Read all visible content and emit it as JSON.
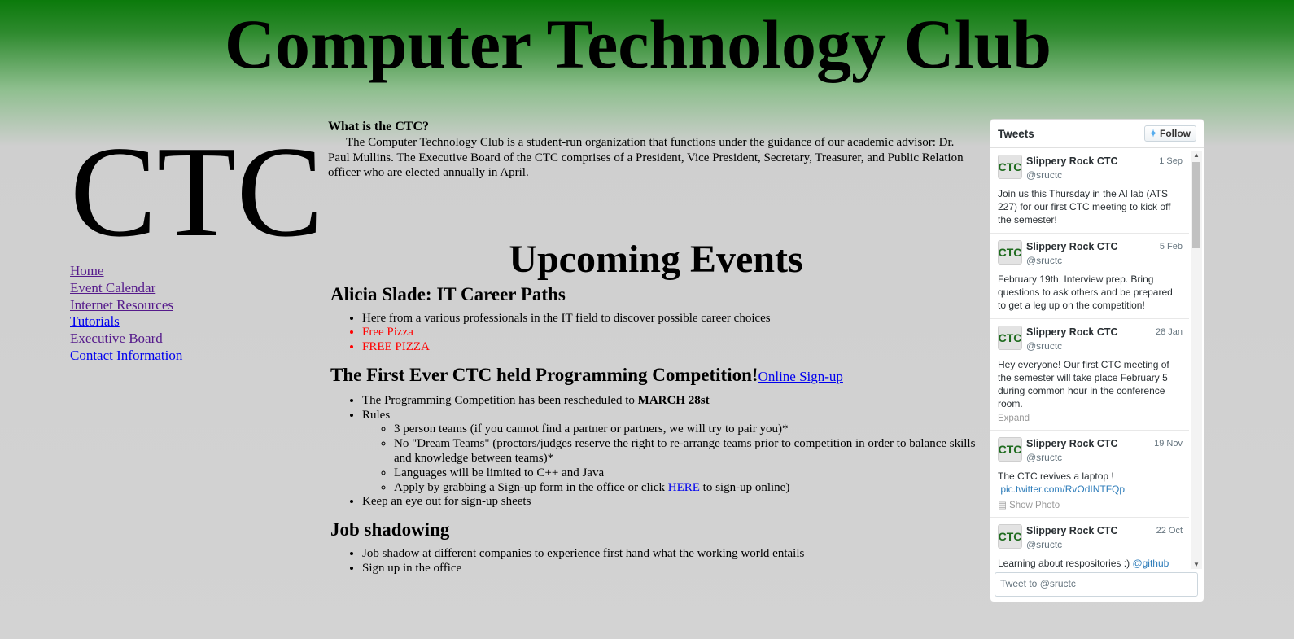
{
  "site": {
    "title": "Computer Technology Club",
    "logo_text": "CTC"
  },
  "nav": {
    "items": [
      {
        "label": "Home"
      },
      {
        "label": "Event Calendar"
      },
      {
        "label": "Internet Resources"
      },
      {
        "label": "Tutorials"
      },
      {
        "label": "Executive Board"
      },
      {
        "label": "Contact Information"
      }
    ]
  },
  "about": {
    "title": "What is the CTC?",
    "text": "The Computer Technology Club is a student-run organization that functions under the guidance of our academic advisor: Dr. Paul Mullins. The Executive Board of the CTC comprises of a President, Vice President, Secretary, Treasurer, and Public Relation officer who are elected annually in April."
  },
  "events": {
    "heading": "Upcoming Events",
    "e1": {
      "title": "Alicia Slade: IT Career Paths",
      "items": [
        "Here from a various professionals in the IT field to discover possible career choices",
        "Free Pizza",
        "FREE PIZZA"
      ]
    },
    "e2": {
      "title": "The First Ever CTC held Programming Competition!",
      "signup_link": "Online Sign-up",
      "rescheduled_prefix": "The Programming Competition has been rescheduled to ",
      "rescheduled_date": "MARCH 28st",
      "rules_label": "Rules",
      "rules": [
        "3 person teams (if you cannot find a partner or partners, we will try to pair you)*",
        "No \"Dream Teams\" (proctors/judges reserve the right to re-arrange teams prior to competition in order to balance skills and knowledge between teams)*",
        "Languages will be limited to C++ and Java"
      ],
      "apply_prefix": "Apply by grabbing a Sign-up form in the office or click ",
      "apply_link": "HERE",
      "apply_suffix": " to sign-up online)",
      "last_item": "Keep an eye out for sign-up sheets"
    },
    "e3": {
      "title": "Job shadowing",
      "items": [
        "Job shadow at different companies to experience first hand what the working world entails",
        "Sign up in the office"
      ]
    }
  },
  "twitter": {
    "title": "Tweets",
    "follow_label": "Follow",
    "compose_placeholder": "Tweet to @sructc",
    "tweets": [
      {
        "name": "Slippery Rock CTC",
        "handle": "@sructc",
        "date": "1 Sep",
        "text": "Join us this Thursday in the AI lab (ATS 227) for our first CTC meeting to kick off the semester!"
      },
      {
        "name": "Slippery Rock CTC",
        "handle": "@sructc",
        "date": "5 Feb",
        "text": "February 19th, Interview prep. Bring questions to ask others and be prepared to get a leg up on the competition!"
      },
      {
        "name": "Slippery Rock CTC",
        "handle": "@sructc",
        "date": "28 Jan",
        "text": "Hey everyone! Our first CTC meeting of the semester will take place February 5 during common hour in the conference room.",
        "expand": "Expand"
      },
      {
        "name": "Slippery Rock CTC",
        "handle": "@sructc",
        "date": "19 Nov",
        "text": "The CTC revives a laptop !",
        "link": "pic.twitter.com/RvOdINTFQp",
        "expand": "Show Photo"
      },
      {
        "name": "Slippery Rock CTC",
        "handle": "@sructc",
        "date": "22 Oct",
        "text": "Learning about respositories :) ",
        "link": "@github"
      }
    ],
    "avatar_text": "CTC"
  }
}
